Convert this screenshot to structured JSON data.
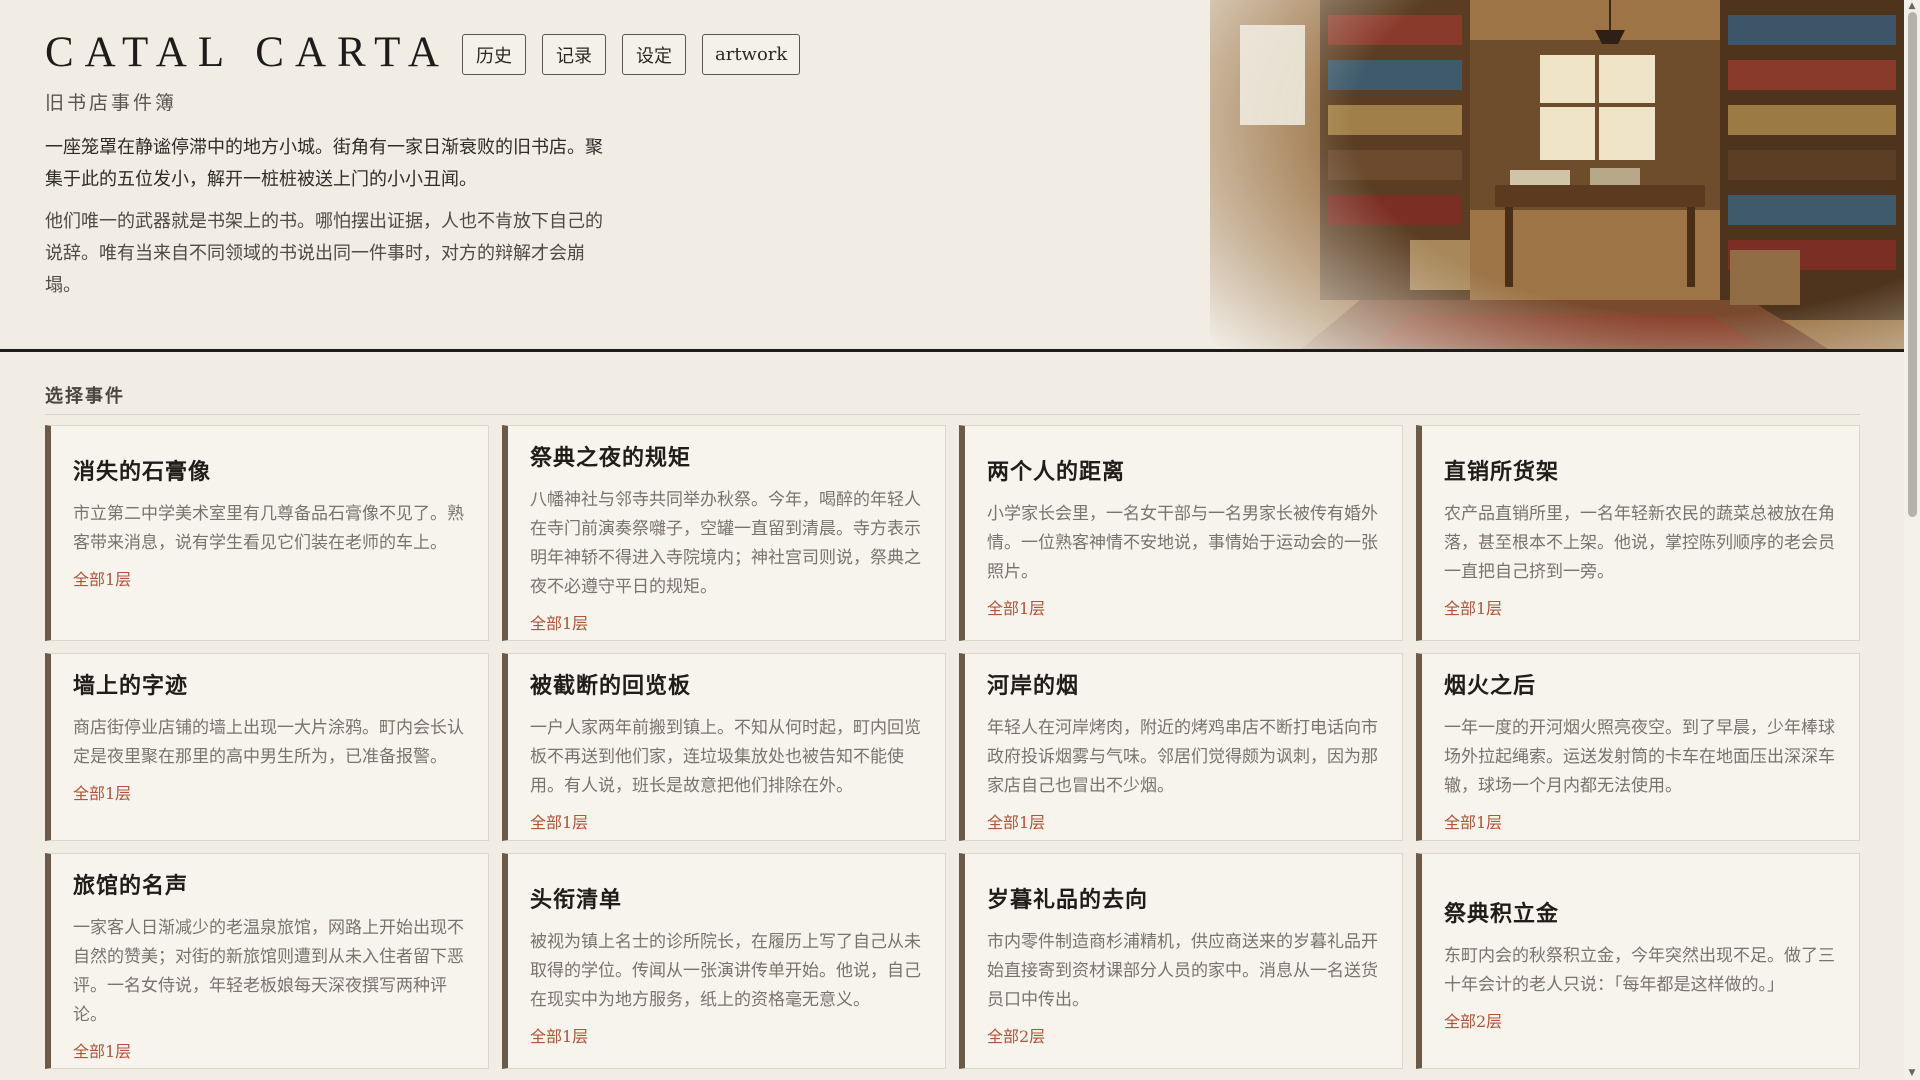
{
  "header": {
    "title": "CATAL CARTA",
    "nav": [
      "历史",
      "记录",
      "设定",
      "artwork"
    ],
    "subtitle": "旧书店事件簿",
    "intro_1": "一座笼罩在静谧停滞中的地方小城。街角有一家日渐衰败的旧书店。聚集于此的五位发小，解开一桩桩被送上门的小小丑闻。",
    "intro_2": "他们唯一的武器就是书架上的书。哪怕摆出证据，人也不肯放下自己的说辞。唯有当来自不同领域的书说出同一件事时，对方的辩解才会崩塌。"
  },
  "section": {
    "label": "选择事件"
  },
  "cards": [
    {
      "title": "消失的石膏像",
      "desc": "市立第二中学美术室里有几尊备品石膏像不见了。熟客带来消息，说有学生看见它们装在老师的车上。",
      "meta": "全部1层"
    },
    {
      "title": "祭典之夜的规矩",
      "desc": "八幡神社与邻寺共同举办秋祭。今年，喝醉的年轻人在寺门前演奏祭囃子，空罐一直留到清晨。寺方表示明年神轿不得进入寺院境内；神社宫司则说，祭典之夜不必遵守平日的规矩。",
      "meta": "全部1层"
    },
    {
      "title": "两个人的距离",
      "desc": "小学家长会里，一名女干部与一名男家长被传有婚外情。一位熟客神情不安地说，事情始于运动会的一张照片。",
      "meta": "全部1层"
    },
    {
      "title": "直销所货架",
      "desc": "农产品直销所里，一名年轻新农民的蔬菜总被放在角落，甚至根本不上架。他说，掌控陈列顺序的老会员一直把自己挤到一旁。",
      "meta": "全部1层"
    },
    {
      "title": "墙上的字迹",
      "desc": "商店街停业店铺的墙上出现一大片涂鸦。町内会长认定是夜里聚在那里的高中男生所为，已准备报警。",
      "meta": "全部1层"
    },
    {
      "title": "被截断的回览板",
      "desc": "一户人家两年前搬到镇上。不知从何时起，町内回览板不再送到他们家，连垃圾集放处也被告知不能使用。有人说，班长是故意把他们排除在外。",
      "meta": "全部1层"
    },
    {
      "title": "河岸的烟",
      "desc": "年轻人在河岸烤肉，附近的烤鸡串店不断打电话向市政府投诉烟雾与气味。邻居们觉得颇为讽刺，因为那家店自己也冒出不少烟。",
      "meta": "全部1层"
    },
    {
      "title": "烟火之后",
      "desc": "一年一度的开河烟火照亮夜空。到了早晨，少年棒球场外拉起绳索。运送发射筒的卡车在地面压出深深车辙，球场一个月内都无法使用。",
      "meta": "全部1层"
    },
    {
      "title": "旅馆的名声",
      "desc": "一家客人日渐减少的老温泉旅馆，网路上开始出现不自然的赞美；对街的新旅馆则遭到从未入住者留下恶评。一名女侍说，年轻老板娘每天深夜撰写两种评论。",
      "meta": "全部1层"
    },
    {
      "title": "头衔清单",
      "desc": "被视为镇上名士的诊所院长，在履历上写了自己从未取得的学位。传闻从一张演讲传单开始。他说，自己在现实中为地方服务，纸上的资格毫无意义。",
      "meta": "全部1层"
    },
    {
      "title": "岁暮礼品的去向",
      "desc": "市内零件制造商杉浦精机，供应商送来的岁暮礼品开始直接寄到资材课部分人员的家中。消息从一名送货员口中传出。",
      "meta": "全部2层"
    },
    {
      "title": "祭典积立金",
      "desc": "东町内会的秋祭积立金，今年突然出现不足。做了三十年会计的老人只说：「每年都是这样做的。」",
      "meta": "全部2层"
    }
  ]
}
